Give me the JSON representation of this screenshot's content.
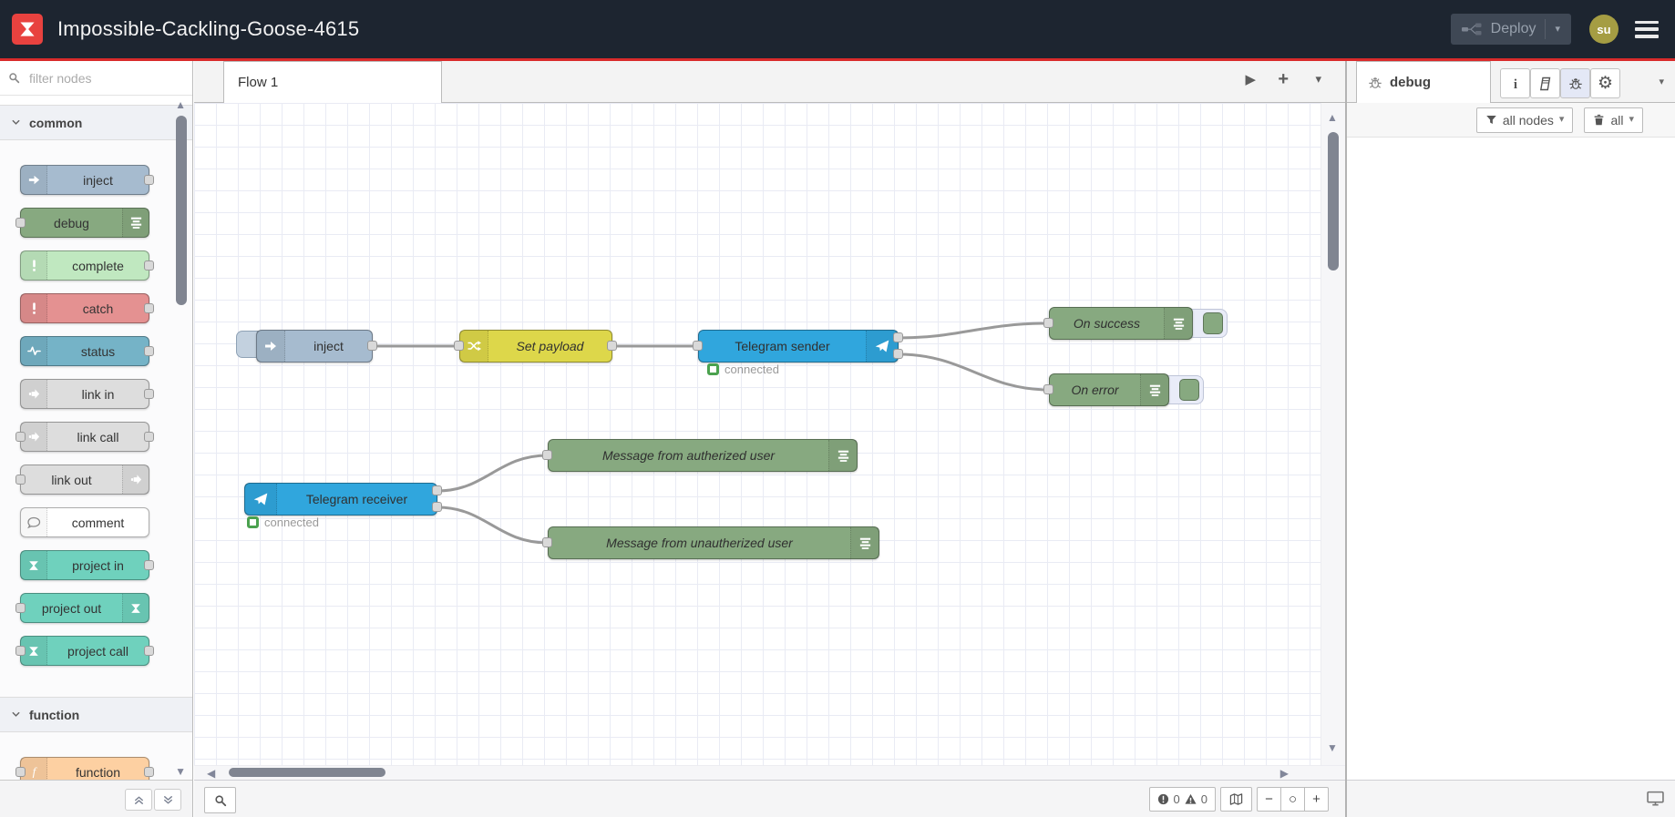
{
  "header": {
    "title": "Impossible-Cackling-Goose-4615",
    "deploy": {
      "label": "Deploy"
    },
    "user": {
      "initials": "su"
    }
  },
  "palette": {
    "search_placeholder": "filter nodes",
    "categories": [
      {
        "label": "common",
        "nodes": [
          {
            "label": "inject",
            "color": "#a6bbcf"
          },
          {
            "label": "debug",
            "color": "#87a980"
          },
          {
            "label": "complete",
            "color": "#c0e8c0"
          },
          {
            "label": "catch",
            "color": "#e49191"
          },
          {
            "label": "status",
            "color": "#75b3c7"
          },
          {
            "label": "link in",
            "color": "#dddddd"
          },
          {
            "label": "link call",
            "color": "#dddddd"
          },
          {
            "label": "link out",
            "color": "#dddddd"
          },
          {
            "label": "comment",
            "color": "#ffffff"
          },
          {
            "label": "project in",
            "color": "#6fd1bd"
          },
          {
            "label": "project out",
            "color": "#6fd1bd"
          },
          {
            "label": "project call",
            "color": "#6fd1bd"
          }
        ]
      },
      {
        "label": "function",
        "nodes": [
          {
            "label": "function",
            "color": "#fdd0a2"
          }
        ]
      }
    ]
  },
  "workspace": {
    "tab": "Flow 1",
    "nodes": [
      {
        "label": "inject",
        "color": "#a6bbcf"
      },
      {
        "label": "Set payload",
        "color": "#ddd74a"
      },
      {
        "label": "Telegram sender",
        "color": "#30a6dd",
        "status": "connected"
      },
      {
        "label": "On success",
        "color": "#87a980"
      },
      {
        "label": "On error",
        "color": "#87a980"
      },
      {
        "label": "Telegram receiver",
        "color": "#30a6dd",
        "status": "connected"
      },
      {
        "label": "Message from autherized user",
        "color": "#87a980"
      },
      {
        "label": "Message from unautherized user",
        "color": "#87a980"
      }
    ]
  },
  "debug_panel": {
    "tab": "debug",
    "filter_label": "all nodes",
    "clear_label": "all"
  },
  "statusbar": {
    "errors": "0",
    "warnings": "0"
  },
  "glyphs": {
    "caret_down": "▾",
    "scroll_up": "▲",
    "scroll_down": "▼",
    "scroll_left": "◀",
    "scroll_right": "▶",
    "play": "▶",
    "plus": "+",
    "gear": "⚙"
  },
  "colors": {
    "header_bg": "#1d2530",
    "accent_red": "#d92b2b",
    "logo_red": "#e8423f",
    "avatar_bg": "#a59d43",
    "status_connected": "#4aa14e",
    "wire": "#999999",
    "grid_line": "#e9ebf4"
  }
}
